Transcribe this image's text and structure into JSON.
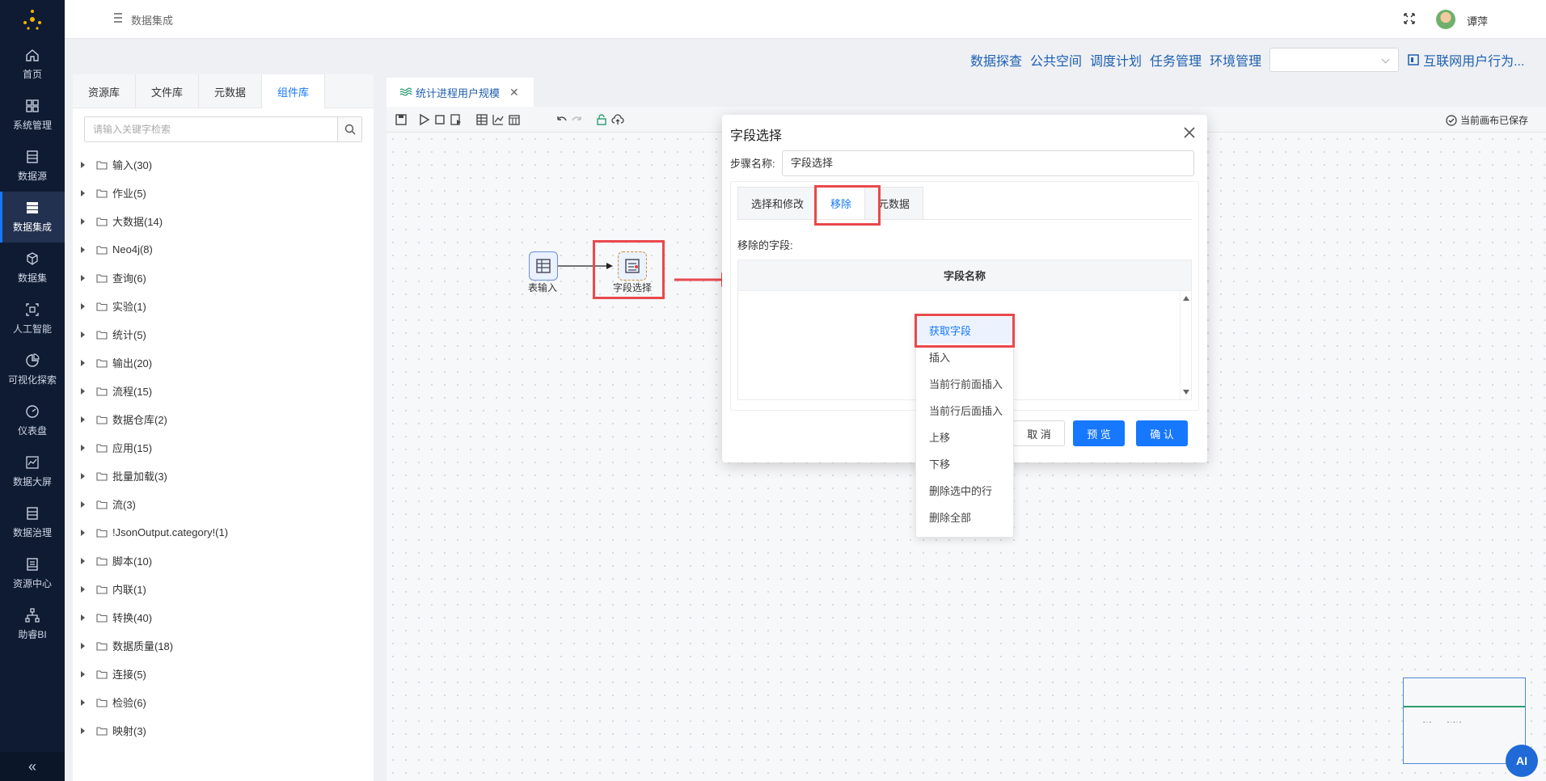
{
  "nav": {
    "items": [
      {
        "label": "首页",
        "icon": "home-icon"
      },
      {
        "label": "系统管理",
        "icon": "grid-icon"
      },
      {
        "label": "数据源",
        "icon": "database-icon"
      },
      {
        "label": "数据集成",
        "icon": "server-icon"
      },
      {
        "label": "数据集",
        "icon": "cube-icon"
      },
      {
        "label": "人工智能",
        "icon": "ai-icon"
      },
      {
        "label": "可视化探索",
        "icon": "pie-chart-icon"
      },
      {
        "label": "仪表盘",
        "icon": "gauge-icon"
      },
      {
        "label": "数据大屏",
        "icon": "line-chart-icon"
      },
      {
        "label": "数据治理",
        "icon": "list-icon"
      },
      {
        "label": "资源中心",
        "icon": "folder-icon"
      },
      {
        "label": "助睿BI",
        "icon": "org-chart-icon"
      }
    ],
    "active_index": 3,
    "collapse_label": "«"
  },
  "header": {
    "title": "数据集成",
    "user": "谭萍"
  },
  "toplinks": {
    "links": [
      "数据探查",
      "公共空间",
      "调度计划",
      "任务管理",
      "环境管理"
    ],
    "project": "互联网用户行为..."
  },
  "left_panel": {
    "tabs": [
      "资源库",
      "文件库",
      "元数据",
      "组件库"
    ],
    "active_tab": 3,
    "search_placeholder": "请输入关键字检索",
    "tree": [
      "输入(30)",
      "作业(5)",
      "大数据(14)",
      "Neo4j(8)",
      "查询(6)",
      "实验(1)",
      "统计(5)",
      "输出(20)",
      "流程(15)",
      "数据仓库(2)",
      "应用(15)",
      "批量加载(3)",
      "流(3)",
      "!JsonOutput.category!(1)",
      "脚本(10)",
      "内联(1)",
      "转换(40)",
      "数据质量(18)",
      "连接(5)",
      "检验(6)",
      "映射(3)"
    ]
  },
  "canvas": {
    "tab_title": "统计进程用户规模",
    "saved_status": "当前画布已保存",
    "nodes": [
      {
        "label": "表输入"
      },
      {
        "label": "字段选择"
      }
    ],
    "ai_label": "AI"
  },
  "dialog": {
    "title": "字段选择",
    "step_name_label": "步骤名称:",
    "step_name_value": "字段选择",
    "tabs": [
      "选择和修改",
      "移除",
      "元数据"
    ],
    "active_tab": 1,
    "removed_fields_label": "移除的字段:",
    "column_header": "字段名称",
    "buttons": {
      "cancel": "取 消",
      "preview": "预 览",
      "ok": "确 认"
    }
  },
  "context_menu": {
    "items": [
      "获取字段",
      "插入",
      "当前行前面插入",
      "当前行后面插入",
      "上移",
      "下移",
      "删除选中的行",
      "删除全部"
    ],
    "highlighted_index": 0
  },
  "colors": {
    "nav_bg": "#0f1b33",
    "accent": "#1677ff",
    "highlight_red": "#e9494c",
    "link": "#1f5fb0"
  }
}
